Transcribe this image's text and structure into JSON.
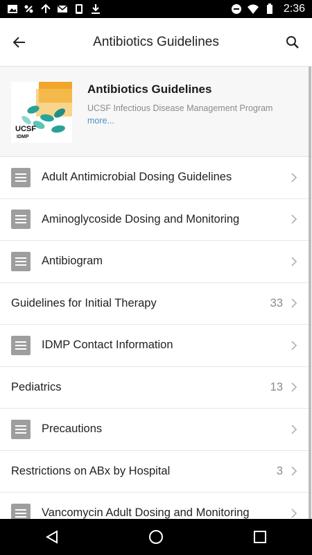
{
  "status_bar": {
    "time": "2:36",
    "icons_left": [
      "image-icon",
      "link-icon",
      "sync-icon",
      "mail-icon",
      "phone-icon",
      "download-icon"
    ],
    "icons_right": [
      "do-not-disturb-icon",
      "wifi-icon",
      "battery-icon"
    ]
  },
  "app_bar": {
    "title": "Antibiotics Guidelines",
    "back_icon": "arrow-left-icon",
    "search_icon": "search-icon"
  },
  "header": {
    "title": "Antibiotics Guidelines",
    "subtitle": "UCSF Infectious Disease Management Program",
    "more": "more...",
    "logo_text_1": "UCSF",
    "logo_text_2": "IDMP"
  },
  "items": [
    {
      "label": "Adult Antimicrobial Dosing Guidelines",
      "icon": "document-icon",
      "count": ""
    },
    {
      "label": "Aminoglycoside Dosing and Monitoring",
      "icon": "document-icon",
      "count": ""
    },
    {
      "label": "Antibiogram",
      "icon": "document-icon",
      "count": ""
    },
    {
      "label": "Guidelines for Initial Therapy",
      "icon": "",
      "count": "33"
    },
    {
      "label": "IDMP Contact Information",
      "icon": "document-icon",
      "count": ""
    },
    {
      "label": "Pediatrics",
      "icon": "",
      "count": "13"
    },
    {
      "label": "Precautions",
      "icon": "document-icon",
      "count": ""
    },
    {
      "label": "Restrictions on ABx by Hospital",
      "icon": "",
      "count": "3"
    },
    {
      "label": "Vancomycin Adult Dosing and Monitoring",
      "icon": "document-icon",
      "count": ""
    }
  ],
  "colors": {
    "accent_link": "#4a90c8",
    "header_bg": "#f7f7f7",
    "icon_gray": "#9e9e9e"
  }
}
